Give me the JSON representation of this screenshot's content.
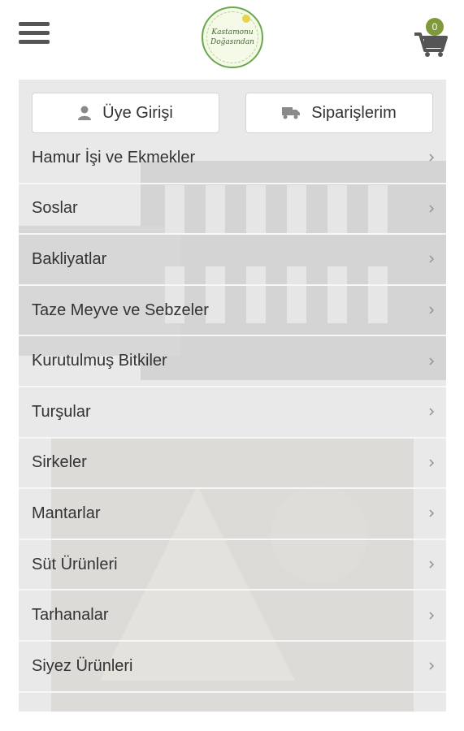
{
  "header": {
    "menu_icon": "hamburger-icon",
    "logo": {
      "line1": "Kastamonu",
      "line2": "Doğasından"
    },
    "cart": {
      "icon": "cart-icon",
      "count": "0",
      "badge_color": "#7f9a3a"
    }
  },
  "actions": {
    "login": {
      "label": "Üye Girişi",
      "icon": "user-icon"
    },
    "orders": {
      "label": "Siparişlerim",
      "icon": "truck-icon"
    }
  },
  "categories": [
    {
      "label": "Hamur İşi ve Ekmekler"
    },
    {
      "label": "Soslar"
    },
    {
      "label": "Bakliyatlar"
    },
    {
      "label": "Taze Meyve ve Sebzeler"
    },
    {
      "label": "Kurutulmuş Bitkiler"
    },
    {
      "label": "Turşular"
    },
    {
      "label": "Sirkeler"
    },
    {
      "label": "Mantarlar"
    },
    {
      "label": "Süt Ürünleri"
    },
    {
      "label": "Tarhanalar"
    },
    {
      "label": "Siyez Ürünleri"
    }
  ],
  "colors": {
    "panel_bg": "#e9e9e9",
    "text": "#333333",
    "accent": "#7f9a3a"
  }
}
